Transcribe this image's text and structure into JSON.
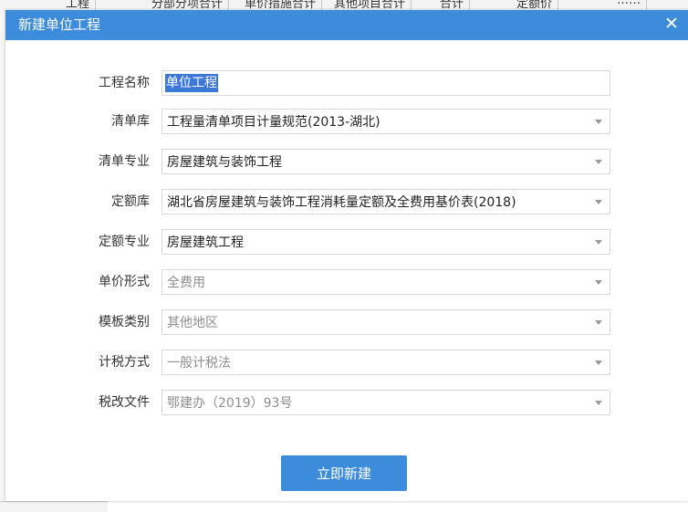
{
  "background": {
    "columns": [
      "工程",
      "分部分项合计",
      "单价措施合计",
      "其他项目合计",
      "合计",
      "定额价",
      "……"
    ]
  },
  "dialog": {
    "title": "新建单位工程",
    "close_glyph": "✕",
    "accent_color": "#3d8cdb",
    "fields": [
      {
        "label": "工程名称",
        "value": "单位工程",
        "type": "text",
        "enabled": true
      },
      {
        "label": "清单库",
        "value": "工程量清单项目计量规范(2013-湖北)",
        "type": "select",
        "enabled": true
      },
      {
        "label": "清单专业",
        "value": "房屋建筑与装饰工程",
        "type": "select",
        "enabled": true
      },
      {
        "label": "定额库",
        "value": "湖北省房屋建筑与装饰工程消耗量定额及全费用基价表(2018)",
        "type": "select",
        "enabled": true
      },
      {
        "label": "定额专业",
        "value": "房屋建筑工程",
        "type": "select",
        "enabled": true
      },
      {
        "label": "单价形式",
        "value": "全费用",
        "type": "select",
        "enabled": false
      },
      {
        "label": "模板类别",
        "value": "其他地区",
        "type": "select",
        "enabled": false
      },
      {
        "label": "计税方式",
        "value": "一般计税法",
        "type": "select",
        "enabled": false
      },
      {
        "label": "税改文件",
        "value": "鄂建办（2019）93号",
        "type": "select",
        "enabled": false
      }
    ],
    "create_button_label": "立即新建"
  }
}
